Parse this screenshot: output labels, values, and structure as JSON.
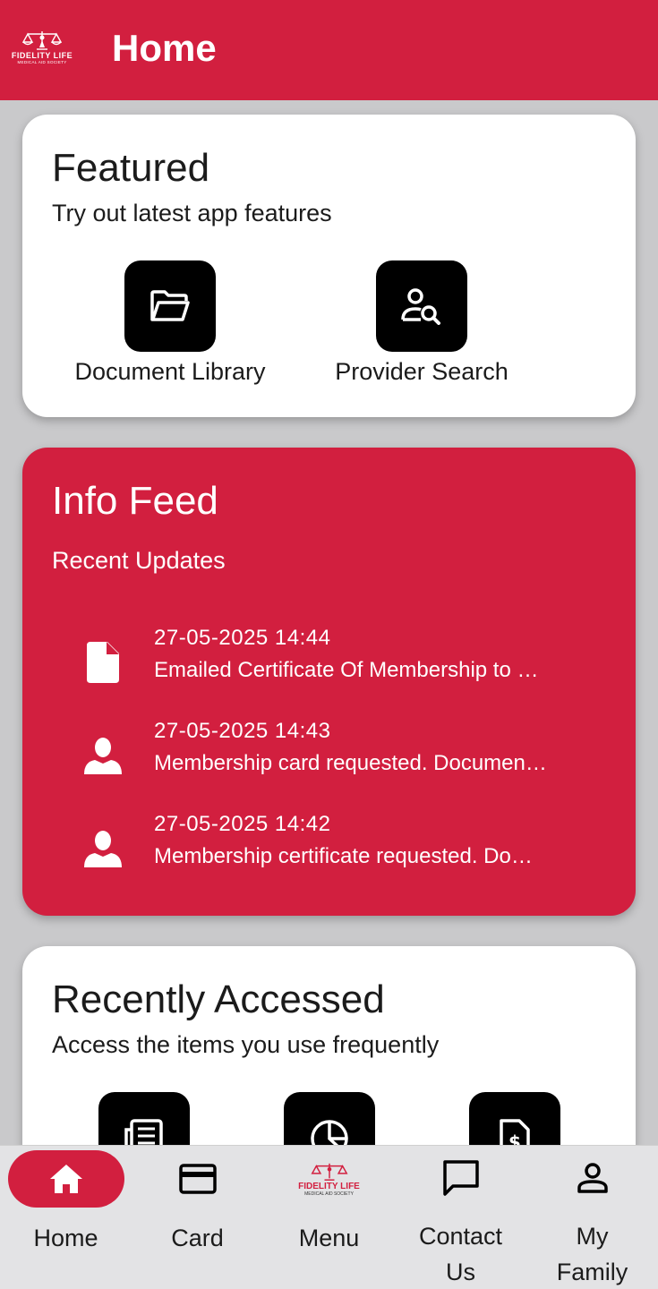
{
  "appbar": {
    "title": "Home",
    "logo_text": "FIDELITY LIFE",
    "logo_sub": "MEDICAL AID SOCIETY"
  },
  "featured": {
    "title": "Featured",
    "subtitle": "Try out latest app features",
    "items": [
      {
        "label": "Document Library",
        "icon": "folder-open-icon"
      },
      {
        "label": "Provider Search",
        "icon": "person-search-icon"
      }
    ]
  },
  "info_feed": {
    "title": "Info Feed",
    "subtitle": "Recent Updates",
    "items": [
      {
        "time": "27-05-2025 14:44",
        "text": "Emailed Certificate Of Membership to …",
        "icon": "document-icon"
      },
      {
        "time": "27-05-2025 14:43",
        "text": "Membership card requested. Documen…",
        "icon": "person-icon"
      },
      {
        "time": "27-05-2025 14:42",
        "text": "Membership certificate requested. Do…",
        "icon": "person-icon"
      }
    ]
  },
  "recent": {
    "title": "Recently Accessed",
    "subtitle": "Access the items you use frequently",
    "icons": [
      "newspaper-icon",
      "pie-chart-icon",
      "invoice-icon"
    ]
  },
  "bottom_nav": {
    "items": [
      {
        "label": "Home",
        "icon": "home-icon",
        "active": true
      },
      {
        "label": "Card",
        "icon": "credit-card-icon"
      },
      {
        "label": "Menu",
        "icon": "fidelity-logo-icon",
        "logo_text": "FIDELITY LIFE",
        "logo_sub": "MEDICAL AID SOCIETY"
      },
      {
        "label": "Contact Us",
        "icon": "chat-icon"
      },
      {
        "label": "My Family",
        "icon": "person-outline-icon"
      }
    ]
  },
  "colors": {
    "brand_red": "#d21f3f",
    "background": "#c9c9cb",
    "nav_background": "#e3e3e5"
  }
}
